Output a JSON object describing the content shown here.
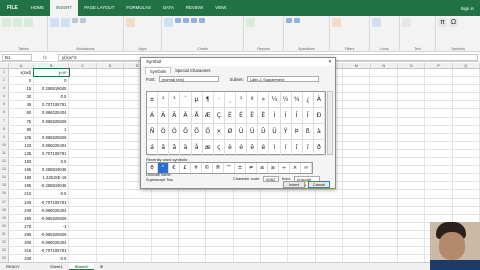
{
  "ribbon": {
    "file_tab": "FILE",
    "tabs": [
      "HOME",
      "INSERT",
      "PAGE LAYOUT",
      "FORMULAS",
      "DATA",
      "REVIEW",
      "VIEW"
    ],
    "sign_in": "Sign in",
    "groups": [
      "Tables",
      "Illustrations",
      "Apps",
      "Charts",
      "Reports",
      "Sparklines",
      "Filters",
      "Links",
      "Text",
      "Symbols"
    ]
  },
  "formula_bar": {
    "name_box": "B1",
    "fx_label": "fx",
    "content": "y(x)x^2"
  },
  "grid": {
    "col_headers": [
      "",
      "A",
      "B",
      "C",
      "D",
      "E",
      "F",
      "G",
      "H",
      "I",
      "J",
      "K",
      "L",
      "M",
      "N",
      "O",
      "P",
      "Q"
    ],
    "rows": [
      {
        "n": "1",
        "a": "x(rad)",
        "b": "y=x²"
      },
      {
        "n": "2",
        "a": "0",
        "b": "0"
      },
      {
        "n": "3",
        "a": "15",
        "b": "0.258819045"
      },
      {
        "n": "4",
        "a": "30",
        "b": "0.5"
      },
      {
        "n": "5",
        "a": "45",
        "b": "0.707106781"
      },
      {
        "n": "6",
        "a": "60",
        "b": "0.866025404"
      },
      {
        "n": "7",
        "a": "75",
        "b": "0.965925826"
      },
      {
        "n": "8",
        "a": "90",
        "b": "1"
      },
      {
        "n": "9",
        "a": "105",
        "b": "0.965925826"
      },
      {
        "n": "10",
        "a": "120",
        "b": "0.866025404"
      },
      {
        "n": "11",
        "a": "135",
        "b": "0.707106781"
      },
      {
        "n": "12",
        "a": "150",
        "b": "0.5"
      },
      {
        "n": "13",
        "a": "165",
        "b": "0.258819045"
      },
      {
        "n": "14",
        "a": "180",
        "b": "1.22515E-16"
      },
      {
        "n": "15",
        "a": "195",
        "b": "-0.258819045"
      },
      {
        "n": "16",
        "a": "210",
        "b": "-0.5"
      },
      {
        "n": "17",
        "a": "225",
        "b": "-0.707106781"
      },
      {
        "n": "18",
        "a": "240",
        "b": "-0.866025404"
      },
      {
        "n": "19",
        "a": "255",
        "b": "-0.965925826"
      },
      {
        "n": "20",
        "a": "270",
        "b": "-1"
      },
      {
        "n": "21",
        "a": "285",
        "b": "-0.965925826"
      },
      {
        "n": "22",
        "a": "300",
        "b": "-0.866025404"
      },
      {
        "n": "23",
        "a": "315",
        "b": "-0.707106781"
      },
      {
        "n": "24",
        "a": "330",
        "b": "-0.5"
      }
    ]
  },
  "sheets": {
    "tabs": [
      "Sheet1",
      "Sheet2"
    ],
    "active": "Sheet2",
    "status": "READY"
  },
  "dialog": {
    "title": "Symbol",
    "close": "✕",
    "tabs": [
      "Symbols",
      "Special Characters"
    ],
    "font_label": "Font:",
    "font_value": "(normal text)",
    "subset_label": "Subset:",
    "subset_value": "Latin-1 Supplement",
    "chars": [
      "±",
      "²",
      "³",
      "´",
      "µ",
      "¶",
      "·",
      "¸",
      "¹",
      "º",
      "»",
      "¼",
      "½",
      "¾",
      "¿",
      "À",
      "Á",
      "Â",
      "Ã",
      "Ä",
      "Å",
      "Æ",
      "Ç",
      "È",
      "É",
      "Ê",
      "Ë",
      "Ì",
      "Í",
      "Î",
      "Ï",
      "Ð",
      "Ñ",
      "Ò",
      "Ó",
      "Ô",
      "Õ",
      "Ö",
      "×",
      "Ø",
      "Ù",
      "Ú",
      "Û",
      "Ü",
      "Ý",
      "Þ",
      "ß",
      "à",
      "á",
      "â",
      "ã",
      "ä",
      "å",
      "æ",
      "ç",
      "è",
      "é",
      "ê",
      "ë",
      "ì",
      "í",
      "î",
      "ï",
      "ð"
    ],
    "recent_label": "Recently used symbols:",
    "recent": [
      "θ",
      "²",
      "€",
      "£",
      "¥",
      "©",
      "®",
      "™",
      "±",
      "≠",
      "≤",
      "≥",
      "÷",
      "×",
      "∞"
    ],
    "unicode_name_label": "Unicode name:",
    "unicode_name": "Superscript Two",
    "char_code_label": "Character code:",
    "char_code": "00B2",
    "from_label": "from:",
    "from_value": "Unicode (hex)",
    "insert_label": "Insert",
    "cancel_label": "Cancel"
  }
}
